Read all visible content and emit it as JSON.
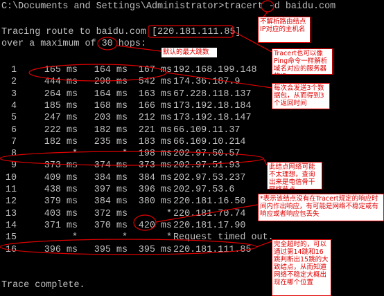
{
  "window": {
    "command_line": "C:\\Documents and Settings\\Administrator>tracert -d baidu.com",
    "tracing_line": "Tracing route to baidu.com [220.181.111.85]",
    "max_hops_line": "over a maximum of 30 hops:",
    "complete_line": "Trace complete."
  },
  "hops": [
    {
      "hop": "1",
      "t1": "165 ms",
      "t2": "164 ms",
      "t3": "167 ms",
      "ip": "192.168.199.148"
    },
    {
      "hop": "2",
      "t1": "444 ms",
      "t2": "290 ms",
      "t3": "542 ms",
      "ip": "174.36.187.9"
    },
    {
      "hop": "3",
      "t1": "264 ms",
      "t2": "164 ms",
      "t3": "163 ms",
      "ip": "67.228.118.137"
    },
    {
      "hop": "4",
      "t1": "185 ms",
      "t2": "168 ms",
      "t3": "166 ms",
      "ip": "173.192.18.184"
    },
    {
      "hop": "5",
      "t1": "247 ms",
      "t2": "203 ms",
      "t3": "212 ms",
      "ip": "173.192.18.147"
    },
    {
      "hop": "6",
      "t1": "222 ms",
      "t2": "182 ms",
      "t3": "221 ms",
      "ip": "66.109.11.37"
    },
    {
      "hop": "7",
      "t1": "182 ms",
      "t2": "235 ms",
      "t3": "183 ms",
      "ip": "66.109.10.214"
    },
    {
      "hop": "8",
      "t1": "*",
      "t2": "*",
      "t3": "198 ms",
      "ip": "202.97.50.57"
    },
    {
      "hop": "9",
      "t1": "373 ms",
      "t2": "374 ms",
      "t3": "373 ms",
      "ip": "202.97.51.93"
    },
    {
      "hop": "10",
      "t1": "409 ms",
      "t2": "384 ms",
      "t3": "384 ms",
      "ip": "202.97.53.237"
    },
    {
      "hop": "11",
      "t1": "438 ms",
      "t2": "397 ms",
      "t3": "396 ms",
      "ip": "202.97.53.6"
    },
    {
      "hop": "12",
      "t1": "379 ms",
      "t2": "384 ms",
      "t3": "380 ms",
      "ip": "220.181.16.50"
    },
    {
      "hop": "13",
      "t1": "403 ms",
      "t2": "372 ms",
      "t3": "*",
      "ip": "220.181.70.74"
    },
    {
      "hop": "14",
      "t1": "371 ms",
      "t2": "370 ms",
      "t3": "420 ms",
      "ip": "220.181.17.90"
    },
    {
      "hop": "15",
      "t1": "*",
      "t2": "*",
      "t3": "*",
      "ip": "Request timed out."
    },
    {
      "hop": "16",
      "t1": "396 ms",
      "t2": "395 ms",
      "t3": "395 ms",
      "ip": "220.181.111.85"
    }
  ],
  "annotations": {
    "no_resolve": "不解析路由结点IP对应的主机名",
    "max_hops": "默认的最大跳数",
    "tracert_ping": "Tracert也可以像Ping命令一样解析域名对应的服务器的IP",
    "three_packets": "每次会发送3个数据包，从而得到3个返回时间",
    "unstable_node": "此结点网络可能不太理想，查询出来是电信骨干网络节点",
    "star_meaning": "*表示该结点没有在Tracert规定的响应时间内作出响应，有可能是网络不稳定或有响应或者响应包丢失",
    "timeout_note": "完全超时的，可以通过第14跳和16跳判断出15跳的大致结点，从而知道网络不稳定大概出现在哪个位置"
  },
  "colors": {
    "background": "#000000",
    "text": "#c0c0c0",
    "annotation": "#e00000"
  }
}
